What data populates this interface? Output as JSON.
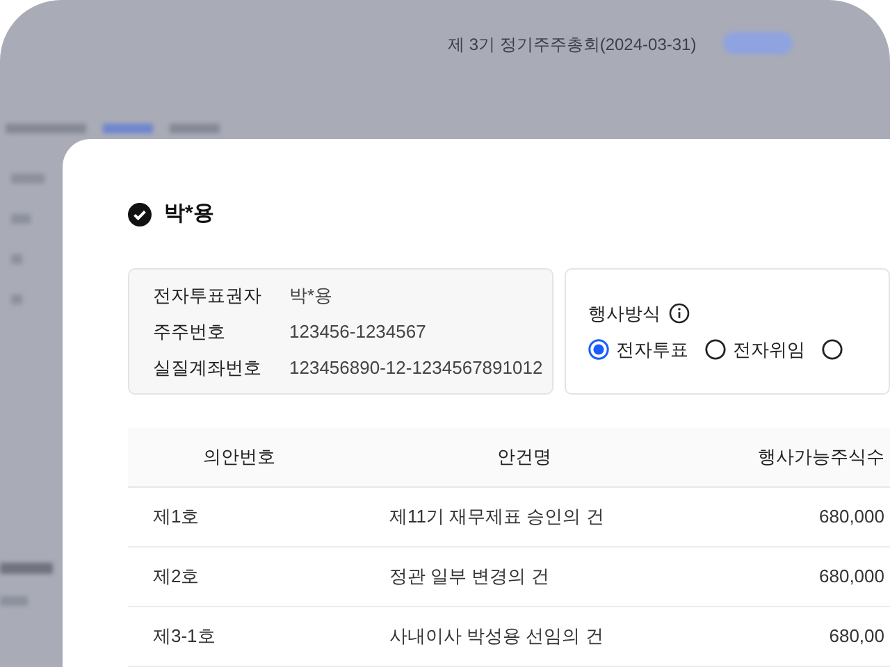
{
  "background": {
    "title": "제 3기 정기주주총회(2024-03-31)"
  },
  "modal": {
    "title": "박*용",
    "checked": true,
    "info": [
      {
        "label": "전자투표권자",
        "value": "박*용"
      },
      {
        "label": "주주번호",
        "value": "123456-1234567"
      },
      {
        "label": "실질계좌번호",
        "value": "123456890-12-1234567891012"
      }
    ],
    "method": {
      "label": "행사방식",
      "options": [
        {
          "label": "전자투표",
          "selected": true
        },
        {
          "label": "전자위임",
          "selected": false
        },
        {
          "selected": false
        }
      ]
    },
    "table": {
      "columns": [
        "의안번호",
        "안건명",
        "행사가능주식수"
      ],
      "rows": [
        [
          "제1호",
          "제11기 재무제표 승인의 건",
          "680,000"
        ],
        [
          "제2호",
          "정관 일부 변경의 건",
          "680,000"
        ],
        [
          "제3-1호",
          "사내이사 박성용 선임의 건",
          "680,00"
        ]
      ]
    }
  }
}
